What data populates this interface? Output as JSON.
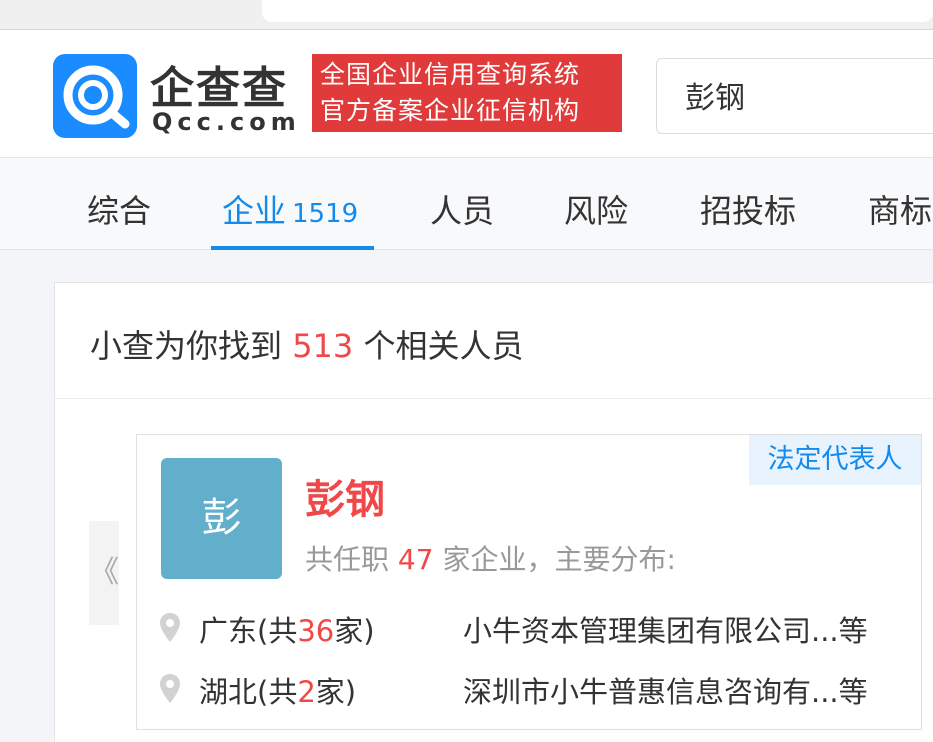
{
  "search": {
    "query": "彭钢"
  },
  "header": {
    "logo_cn": "企查查",
    "logo_en": "Qcc.com",
    "slogan_line1": "全国企业信用查询系统",
    "slogan_line2": "官方备案企业征信机构"
  },
  "tabs": [
    {
      "label": "综合"
    },
    {
      "label": "企业",
      "count": "1519"
    },
    {
      "label": "人员"
    },
    {
      "label": "风险"
    },
    {
      "label": "招投标"
    },
    {
      "label": "商标"
    }
  ],
  "results": {
    "summary_prefix": "小查为你找到",
    "count": "513",
    "summary_suffix": "个相关人员"
  },
  "person": {
    "avatar_char": "彭",
    "name": "彭钢",
    "role_tag": "法定代表人",
    "position_prefix": "共任职",
    "position_count": "47",
    "position_suffix": "家企业，主要分布:",
    "regions": [
      {
        "prefix": "广东(共",
        "count": "36",
        "suffix": "家)",
        "company": "小牛资本管理集团有限公司...等"
      },
      {
        "prefix": "湖北(共",
        "count": "2",
        "suffix": "家)",
        "company": "深圳市小牛普惠信息咨询有...等"
      }
    ]
  },
  "carousel": {
    "prev_label": "《"
  },
  "colors": {
    "brand_blue": "#128bed",
    "highlight_red": "#f04848",
    "avatar_bg": "#62afcb",
    "slogan_bg": "#e03a3a"
  }
}
